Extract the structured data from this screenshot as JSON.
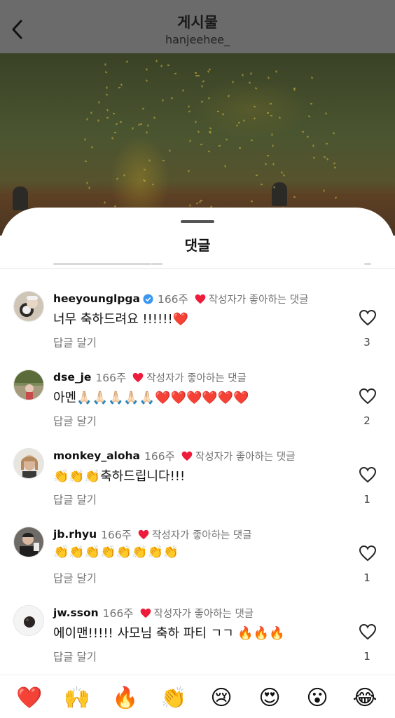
{
  "header": {
    "title": "게시물",
    "username": "hanjeehee_"
  },
  "sheet": {
    "title": "댓글"
  },
  "comments": [
    {
      "username": "heeyounglpga",
      "verified": true,
      "time": "166주",
      "liked_by_author": "작성자가 좋아하는 댓글",
      "text": "너무 축하드려요 !!!!!!❤️",
      "reply": "답글 달기",
      "likes": "3"
    },
    {
      "username": "dse_je",
      "verified": false,
      "time": "166주",
      "liked_by_author": "작성자가 좋아하는 댓글",
      "text": "아멘🙏🏻🙏🏻🙏🏻🙏🏻🙏🏻❤️❤️❤️❤️❤️❤️",
      "reply": "답글 달기",
      "likes": "2"
    },
    {
      "username": "monkey_aloha",
      "verified": false,
      "time": "166주",
      "liked_by_author": "작성자가 좋아하는 댓글",
      "text": "👏👏👏축하드립니다!!!",
      "reply": "답글 달기",
      "likes": "1"
    },
    {
      "username": "jb.rhyu",
      "verified": false,
      "time": "166주",
      "liked_by_author": "작성자가 좋아하는 댓글",
      "text": "👏👏👏👏👏👏👏👏",
      "reply": "답글 달기",
      "likes": "1"
    },
    {
      "username": "jw.sson",
      "verified": false,
      "time": "166주",
      "liked_by_author": "작성자가 좋아하는 댓글",
      "text": "에이맨!!!!! 사모님 축하 파티 ㄱㄱ 🔥🔥🔥",
      "reply": "답글 달기",
      "likes": "1"
    }
  ],
  "reactions": [
    "❤️",
    "🙌",
    "🔥",
    "👏",
    "😢",
    "😍",
    "😮",
    "😂"
  ],
  "icons": {
    "back": "chevron-left-icon",
    "like": "heart-outline-icon",
    "liked": "heart-filled-icon",
    "verified": "verified-badge-icon"
  },
  "colors": {
    "heart": "#ed1c3b",
    "verified": "#3897f0",
    "muted": "#737373"
  }
}
